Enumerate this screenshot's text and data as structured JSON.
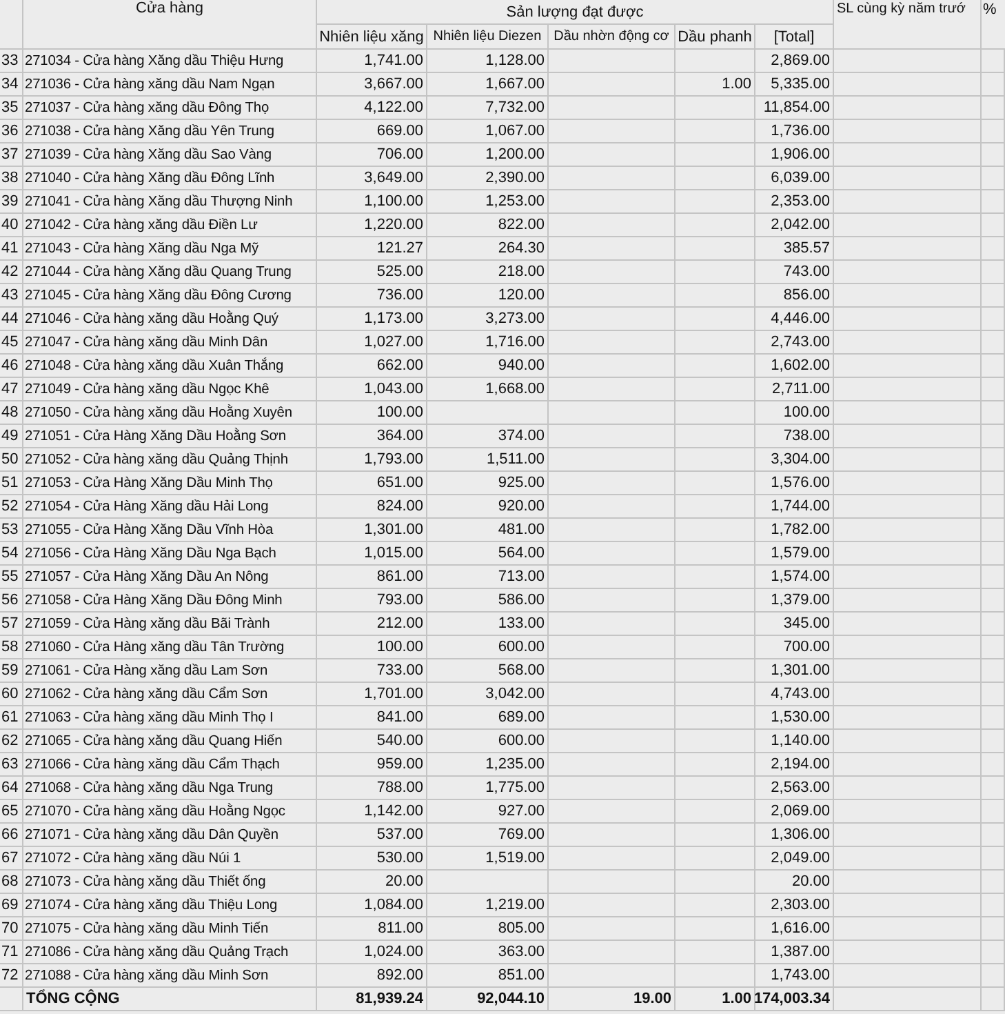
{
  "header": {
    "store": "Cửa hàng",
    "group": "Sản lượng đạt được",
    "prior_year": "SL cùng kỳ năm trướ",
    "percent": "%",
    "columns": [
      "Nhiên liệu xăng",
      "Nhiên liệu Diezen",
      "Dầu nhờn động cơ",
      "Dầu phanh",
      "[Total]"
    ]
  },
  "rows": [
    {
      "no": "33",
      "store": "271034 - Cửa hàng Xăng dầu Thiệu Hưng",
      "gasoline": "1,741.00",
      "diesel": "1,128.00",
      "total": "2,869.00"
    },
    {
      "no": "34",
      "store": "271036 - Cửa hàng xăng dầu Nam Ngạn",
      "gasoline": "3,667.00",
      "diesel": "1,667.00",
      "brake_fluid": "1.00",
      "total": "5,335.00"
    },
    {
      "no": "35",
      "store": "271037 - Cửa hàng xăng dầu Đông Thọ",
      "gasoline": "4,122.00",
      "diesel": "7,732.00",
      "total": "11,854.00"
    },
    {
      "no": "36",
      "store": "271038 - Cửa hàng Xăng dầu Yên Trung",
      "gasoline": "669.00",
      "diesel": "1,067.00",
      "total": "1,736.00"
    },
    {
      "no": "37",
      "store": "271039 - Cửa hàng Xăng dầu Sao Vàng",
      "gasoline": "706.00",
      "diesel": "1,200.00",
      "total": "1,906.00"
    },
    {
      "no": "38",
      "store": "271040 - Cửa hàng Xăng dầu Đông Lĩnh",
      "gasoline": "3,649.00",
      "diesel": "2,390.00",
      "total": "6,039.00"
    },
    {
      "no": "39",
      "store": "271041 - Cửa hàng Xăng dầu Thượng Ninh",
      "gasoline": "1,100.00",
      "diesel": "1,253.00",
      "total": "2,353.00"
    },
    {
      "no": "40",
      "store": "271042 - Cửa hàng xăng dầu Điền Lư",
      "gasoline": "1,220.00",
      "diesel": "822.00",
      "total": "2,042.00"
    },
    {
      "no": "41",
      "store": "271043 - Cửa hàng Xăng dầu Nga Mỹ",
      "gasoline": "121.27",
      "diesel": "264.30",
      "total": "385.57"
    },
    {
      "no": "42",
      "store": "271044 - Cửa hàng Xăng dầu Quang Trung",
      "gasoline": "525.00",
      "diesel": "218.00",
      "total": "743.00"
    },
    {
      "no": "43",
      "store": "271045 - Cửa hàng Xăng dầu Đông Cương",
      "gasoline": "736.00",
      "diesel": "120.00",
      "total": "856.00"
    },
    {
      "no": "44",
      "store": "271046 - Cửa hàng xăng dầu Hoằng Quý",
      "gasoline": "1,173.00",
      "diesel": "3,273.00",
      "total": "4,446.00"
    },
    {
      "no": "45",
      "store": "271047 - Cửa hàng xăng dầu Minh Dân",
      "gasoline": "1,027.00",
      "diesel": "1,716.00",
      "total": "2,743.00"
    },
    {
      "no": "46",
      "store": "271048 - Cửa hàng xăng dầu Xuân Thắng",
      "gasoline": "662.00",
      "diesel": "940.00",
      "total": "1,602.00"
    },
    {
      "no": "47",
      "store": "271049 - Cửa hàng xăng dầu Ngọc Khê",
      "gasoline": "1,043.00",
      "diesel": "1,668.00",
      "total": "2,711.00"
    },
    {
      "no": "48",
      "store": "271050 - Cửa hàng xăng dầu Hoằng Xuyên",
      "gasoline": "100.00",
      "total": "100.00"
    },
    {
      "no": "49",
      "store": "271051 - Cửa Hàng Xăng Dầu Hoằng Sơn",
      "gasoline": "364.00",
      "diesel": "374.00",
      "total": "738.00"
    },
    {
      "no": "50",
      "store": "271052 - Cửa hàng xăng dầu Quảng Thịnh",
      "gasoline": "1,793.00",
      "diesel": "1,511.00",
      "total": "3,304.00"
    },
    {
      "no": "51",
      "store": "271053 - Cửa Hàng Xăng Dầu Minh Thọ",
      "gasoline": "651.00",
      "diesel": "925.00",
      "total": "1,576.00"
    },
    {
      "no": "52",
      "store": "271054 - Cửa Hàng Xăng dầu Hải Long",
      "gasoline": "824.00",
      "diesel": "920.00",
      "total": "1,744.00"
    },
    {
      "no": "53",
      "store": "271055 - Cửa Hàng Xăng Dầu Vĩnh Hòa",
      "gasoline": "1,301.00",
      "diesel": "481.00",
      "total": "1,782.00"
    },
    {
      "no": "54",
      "store": "271056 - Cửa Hàng Xăng Dầu Nga Bạch",
      "gasoline": "1,015.00",
      "diesel": "564.00",
      "total": "1,579.00"
    },
    {
      "no": "55",
      "store": "271057 - Cửa Hàng Xăng Dầu An Nông",
      "gasoline": "861.00",
      "diesel": "713.00",
      "total": "1,574.00"
    },
    {
      "no": "56",
      "store": "271058 - Cửa Hàng Xăng Dầu Đông Minh",
      "gasoline": "793.00",
      "diesel": "586.00",
      "total": "1,379.00"
    },
    {
      "no": "57",
      "store": "271059 - Cửa Hàng xăng dầu Bãi Trành",
      "gasoline": "212.00",
      "diesel": "133.00",
      "total": "345.00"
    },
    {
      "no": "58",
      "store": "271060 - Cửa Hàng xăng dầu Tân Trường",
      "gasoline": "100.00",
      "diesel": "600.00",
      "total": "700.00"
    },
    {
      "no": "59",
      "store": "271061 - Cửa Hàng xăng dầu Lam Sơn",
      "gasoline": "733.00",
      "diesel": "568.00",
      "total": "1,301.00"
    },
    {
      "no": "60",
      "store": "271062 - Cửa hàng xăng dầu Cẩm Sơn",
      "gasoline": "1,701.00",
      "diesel": "3,042.00",
      "total": "4,743.00"
    },
    {
      "no": "61",
      "store": "271063 - Cửa hàng xăng dầu Minh Thọ I",
      "gasoline": "841.00",
      "diesel": "689.00",
      "total": "1,530.00"
    },
    {
      "no": "62",
      "store": "271065 - Cửa hàng xăng dầu Quang Hiến",
      "gasoline": "540.00",
      "diesel": "600.00",
      "total": "1,140.00"
    },
    {
      "no": "63",
      "store": "271066 - Cửa hàng xăng dầu Cẩm Thạch",
      "gasoline": "959.00",
      "diesel": "1,235.00",
      "total": "2,194.00"
    },
    {
      "no": "64",
      "store": "271068 - Cửa hàng xăng dầu Nga Trung",
      "gasoline": "788.00",
      "diesel": "1,775.00",
      "total": "2,563.00"
    },
    {
      "no": "65",
      "store": "271070 - Cửa hàng xăng dầu Hoằng Ngọc",
      "gasoline": "1,142.00",
      "diesel": "927.00",
      "total": "2,069.00"
    },
    {
      "no": "66",
      "store": "271071 - Cửa hàng xăng dầu Dân Quyền",
      "gasoline": "537.00",
      "diesel": "769.00",
      "total": "1,306.00"
    },
    {
      "no": "67",
      "store": "271072 - Cửa hàng xăng dầu Núi 1",
      "gasoline": "530.00",
      "diesel": "1,519.00",
      "total": "2,049.00"
    },
    {
      "no": "68",
      "store": "271073 - Cửa hàng xăng dầu Thiết ống",
      "gasoline": "20.00",
      "total": "20.00"
    },
    {
      "no": "69",
      "store": "271074 - Cửa hàng xăng dầu Thiệu Long",
      "gasoline": "1,084.00",
      "diesel": "1,219.00",
      "total": "2,303.00"
    },
    {
      "no": "70",
      "store": "271075 - Cửa hàng xăng dầu Minh Tiến",
      "gasoline": "811.00",
      "diesel": "805.00",
      "total": "1,616.00"
    },
    {
      "no": "71",
      "store": "271086 - Cửa hàng xăng dầu Quảng Trạch",
      "gasoline": "1,024.00",
      "diesel": "363.00",
      "total": "1,387.00"
    },
    {
      "no": "72",
      "store": "271088 - Cửa hàng xăng dầu Minh Sơn",
      "gasoline": "892.00",
      "diesel": "851.00",
      "total": "1,743.00"
    }
  ],
  "total": {
    "label": "TỔNG CỘNG",
    "gasoline": "81,939.24",
    "diesel": "92,044.10",
    "engine_oil": "19.00",
    "brake_fluid": "1.00",
    "total": "174,003.34"
  }
}
